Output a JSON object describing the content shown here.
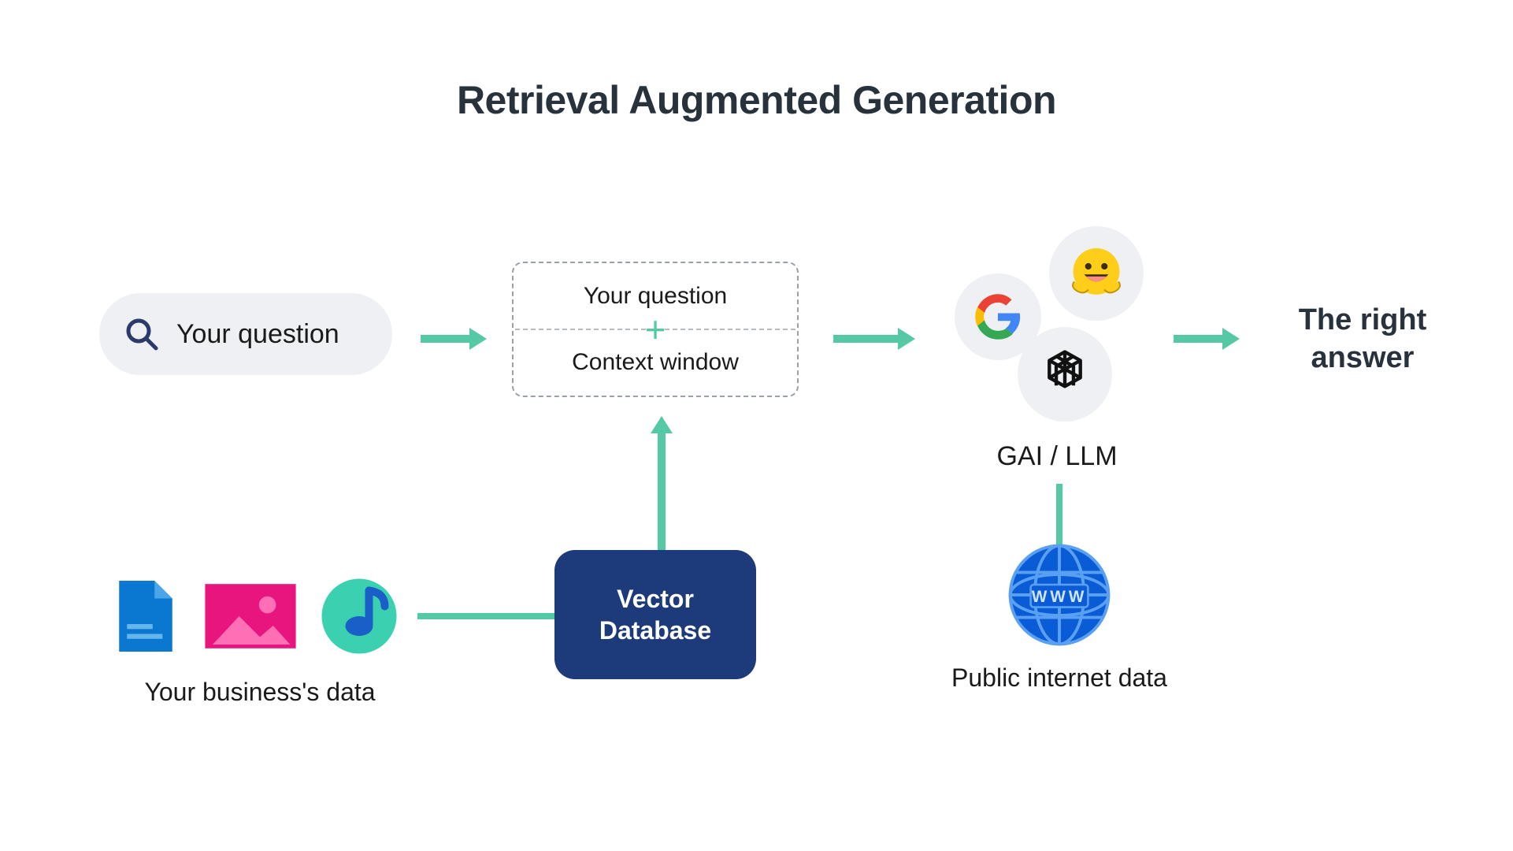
{
  "title": "Retrieval Augmented Generation",
  "question_pill": {
    "label": "Your question"
  },
  "dashed_box": {
    "top_label": "Your question",
    "bottom_label": "Context window",
    "plus": "+"
  },
  "gai": {
    "label": "GAI / LLM",
    "icons": {
      "google": "google-logo",
      "hugging": "huggingface-logo",
      "openai": "openai-logo"
    }
  },
  "answer": {
    "text": "The right answer"
  },
  "business_data": {
    "label": "Your business's data",
    "icons": {
      "doc": "document-icon",
      "image": "image-icon",
      "music": "music-icon"
    }
  },
  "vector_db": {
    "label": "Vector Database"
  },
  "public_internet": {
    "label": "Public internet data",
    "www": "WWW"
  },
  "colors": {
    "arrow": "#55c9a6",
    "pill_bg": "#eef0f4",
    "dark_text": "#28323c",
    "db_bg": "#1d3a7a",
    "doc_blue": "#0a78d0",
    "img_pink": "#e8157e",
    "music_teal": "#3bd1b0",
    "globe_blue": "#0a5cd6"
  }
}
